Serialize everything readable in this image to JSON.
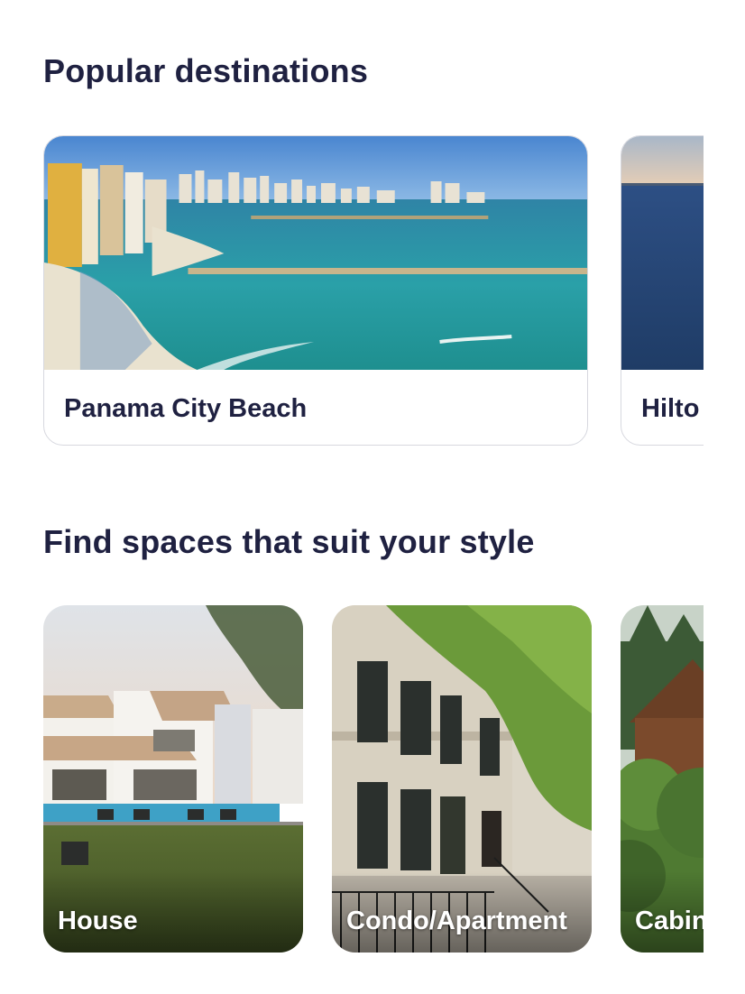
{
  "popular_destinations": {
    "title": "Popular destinations",
    "cards": [
      {
        "label": "Panama City Beach",
        "image": "beach-skyline-photo"
      },
      {
        "label": "Hilto",
        "image": "ocean-photo"
      }
    ]
  },
  "styles": {
    "title": "Find spaces that suit your style",
    "cards": [
      {
        "label": "House",
        "image": "house-with-pool-photo"
      },
      {
        "label": "Condo/Apartment",
        "image": "brownstone-building-photo"
      },
      {
        "label": "Cabin",
        "image": "cabin-in-woods-photo"
      }
    ]
  },
  "colors": {
    "heading": "#1f2141",
    "card_border": "#d7d8df",
    "background": "#ffffff"
  }
}
